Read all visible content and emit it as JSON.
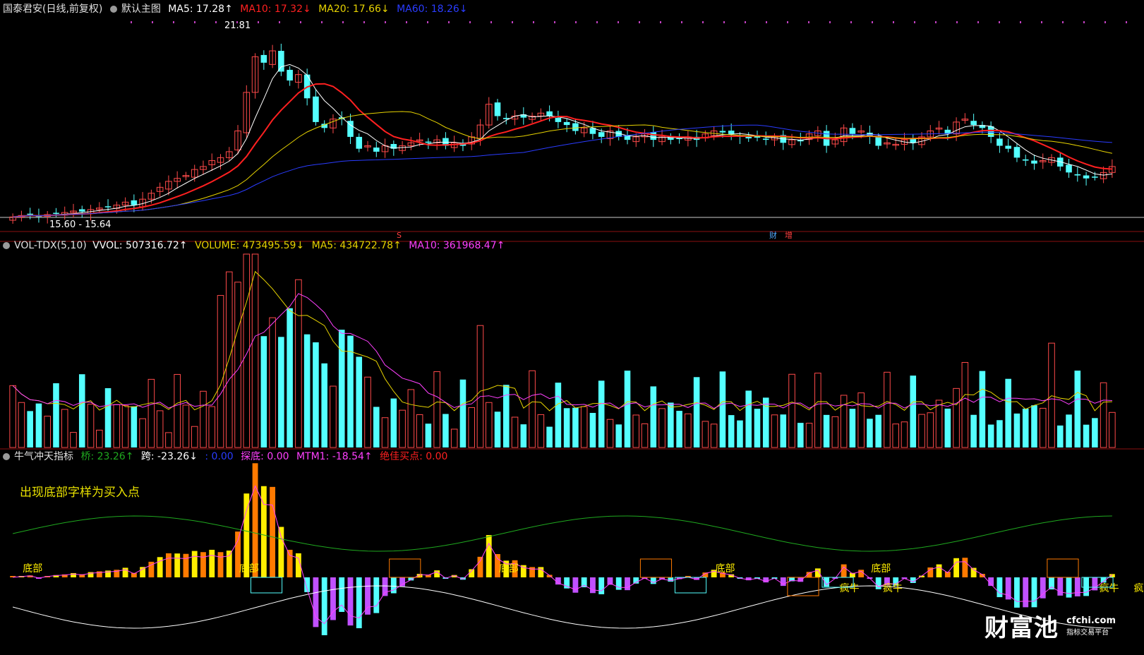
{
  "panel1": {
    "title": "国泰君安(日线,前复权)",
    "main_label": "默认主图",
    "ma5": "MA5: 17.28↑",
    "ma10": "MA10: 17.32↓",
    "ma20": "MA20: 17.66↓",
    "ma60": "MA60: 18.26↓",
    "high_label": "21.81",
    "low_label": "15.60 - 15.64",
    "marker_s": "S",
    "marker_cai": "财",
    "marker_zeng": "增"
  },
  "panel2": {
    "title": "VOL-TDX(5,10)",
    "vvol": "VVOL: 507316.72↑",
    "volume": "VOLUME: 473495.59↓",
    "ma5": "MA5: 434722.78↑",
    "ma10": "MA10: 361968.47↑"
  },
  "panel3": {
    "title": "牛气冲天指标",
    "qiao": "桥: 23.26↑",
    "kua": "跨: -23.26↓",
    "blank": ": 0.00",
    "tandi": "探底: 0.00",
    "mtm1": "MTM1: -18.54↑",
    "juejia": "绝佳买点: 0.00",
    "note": "出现底部字样为买入点",
    "bottom_label": "底部",
    "crazy_bull": "疯牛"
  },
  "watermark": {
    "brand": "财富池",
    "domain": "cfchi.com",
    "sub": "指标交易平台"
  },
  "colors": {
    "up": "#ff4a4a",
    "down": "#54ffff",
    "ma5": "#ffffff",
    "ma10": "#ff2020",
    "ma20": "#e6d200",
    "ma60": "#2a3cff",
    "purple": "#ff40ff",
    "orange": "#ff7a00",
    "yellow": "#ffee00",
    "violet": "#c050ff",
    "green": "#1fa81f"
  },
  "chart_data": [
    {
      "type": "candlestick",
      "title": "国泰君安(日线,前复权)",
      "series_closes": [
        15.6,
        15.65,
        15.7,
        15.62,
        15.68,
        15.72,
        15.75,
        15.8,
        15.78,
        15.85,
        15.9,
        15.95,
        16.0,
        16.1,
        16.0,
        16.2,
        16.4,
        16.6,
        16.8,
        16.9,
        17.0,
        17.2,
        17.3,
        17.5,
        17.6,
        17.8,
        18.5,
        19.8,
        21.0,
        20.8,
        21.2,
        20.5,
        20.2,
        20.4,
        19.6,
        18.8,
        18.6,
        18.9,
        18.9,
        18.3,
        17.9,
        18.0,
        17.8,
        18.0,
        17.9,
        18.0,
        18.1,
        18.2,
        18.1,
        18.2,
        18.0,
        18.1,
        18.0,
        18.3,
        18.7,
        19.4,
        19.0,
        18.9,
        19.0,
        18.95,
        19.0,
        19.1,
        19.0,
        18.8,
        18.7,
        18.5,
        18.6,
        18.4,
        18.3,
        18.5,
        18.3,
        18.2,
        18.3,
        18.4,
        18.2,
        18.3,
        18.2,
        18.25,
        18.3,
        18.2,
        18.4,
        18.5,
        18.45,
        18.4,
        18.3,
        18.25,
        18.3,
        18.2,
        18.3,
        18.1,
        18.2,
        18.15,
        18.4,
        18.5,
        18.0,
        18.2,
        18.6,
        18.4,
        18.5,
        18.3,
        18.0,
        18.1,
        18.05,
        18.2,
        18.1,
        18.3,
        18.5,
        18.6,
        18.4,
        18.8,
        18.9,
        18.7,
        18.6,
        18.3,
        18.0,
        17.9,
        17.6,
        17.5,
        17.4,
        17.5,
        17.6,
        17.3,
        17.1,
        17.0,
        16.9,
        16.95,
        17.1,
        17.3
      ],
      "ma_values": {
        "MA5": 17.28,
        "MA10": 17.32,
        "MA20": 17.66,
        "MA60": 18.26
      },
      "annotations": [
        "21.81",
        "15.60 - 15.64"
      ]
    },
    {
      "type": "bar",
      "title": "VOL-TDX(5,10)",
      "values": {
        "VVOL": 507316.72,
        "VOLUME": 473495.59,
        "MA5": 434722.78,
        "MA10": 361968.47
      }
    },
    {
      "type": "bar",
      "title": "牛气冲天指标",
      "values": {
        "桥": 23.26,
        "跨": -23.26,
        "探底": 0.0,
        "MTM1": -18.54,
        "绝佳买点": 0.0
      }
    }
  ]
}
